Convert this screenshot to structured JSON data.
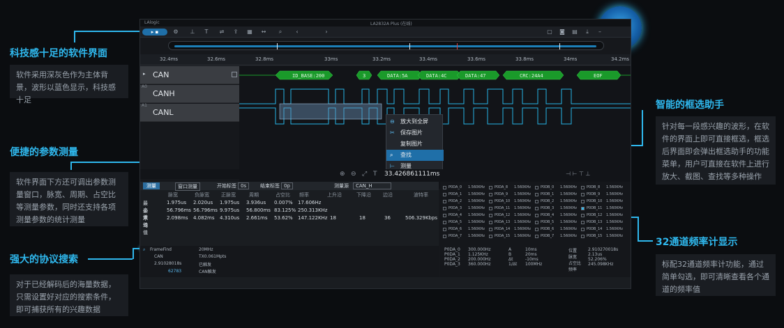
{
  "window": {
    "app_name": "LAlogic",
    "title": "LA2832A Plus (在线)"
  },
  "toolbar": {
    "run_label": "▸ ▪"
  },
  "ruler": {
    "ticks": [
      "32.4ms",
      "32.6ms",
      "32.8ms",
      "33ms",
      "33.2ms",
      "33.4ms",
      "33.6ms",
      "33.8ms",
      "34ms",
      "34.2ms"
    ]
  },
  "channels": [
    {
      "name": "CAN",
      "number": ""
    },
    {
      "name": "CANH",
      "number": "A0"
    },
    {
      "name": "CANL",
      "number": "A1"
    }
  ],
  "decode": {
    "segments": [
      "ID_BASE:200",
      "3",
      "DATA:5A",
      "DATA:4C",
      "DATA:47",
      "CRC:24A4",
      "EOF"
    ]
  },
  "context_menu": {
    "items": [
      "放大到全屏",
      "保存图片",
      "复制图片",
      "查找",
      "测量"
    ],
    "selected_index": 3
  },
  "status": {
    "cursor_time": "33.426861111ms"
  },
  "measure": {
    "tab_label": "测量",
    "mode_label": "窗口测量",
    "start_label": "开始标签",
    "start_value": "0s",
    "end_label": "结束标签",
    "end_value": "0p",
    "source_label": "测量源",
    "source_value": "CAN_H",
    "columns": [
      "",
      "脉宽",
      "负脉宽",
      "正脉宽",
      "周期",
      "占空比",
      "频率",
      "上升沿",
      "下降沿",
      "边沿",
      "波特率"
    ],
    "rows": [
      {
        "label": "最小值",
        "values": [
          "1.975us",
          "2.020us",
          "1.975us",
          "3.936us",
          "0.007%",
          "17.606Hz",
          "",
          "",
          "",
          ""
        ]
      },
      {
        "label": "最大值",
        "values": [
          "56.796ms",
          "56.796ms",
          "9.975us",
          "56.800ms",
          "83.125%",
          "250.313KHz",
          "",
          "",
          "",
          ""
        ]
      },
      {
        "label": "平均值",
        "values": [
          "2.098ms",
          "4.082ms",
          "4.310us",
          "2.661ms",
          "53.62%",
          "147.122KHz",
          "18",
          "18",
          "36",
          "506.329Kbps"
        ]
      }
    ]
  },
  "freq_counter": {
    "channels": [
      [
        "P0DA_0",
        "1.560KHz",
        "P0DA_8",
        "1.560KHz",
        "P0DB_0",
        "1.560KHz",
        "P0DB_8",
        "1.560KHz"
      ],
      [
        "P0DA_1",
        "1.560KHz",
        "P0DA_9",
        "1.560KHz",
        "P0DB_1",
        "1.560KHz",
        "P0DB_9",
        "1.560KHz"
      ],
      [
        "P0DA_2",
        "1.560KHz",
        "P0DA_10",
        "1.560KHz",
        "P0DB_2",
        "1.560KHz",
        "P0DB_10",
        "1.560KHz"
      ],
      [
        "P0DA_3",
        "1.560KHz",
        "P0DA_11",
        "1.560KHz",
        "P0DB_3",
        "1.560KHz",
        "P0DB_11",
        "1.560KHz"
      ],
      [
        "P0DA_4",
        "1.560KHz",
        "P0DA_12",
        "1.560KHz",
        "P0DB_4",
        "1.560KHz",
        "P0DB_12",
        "1.560KHz"
      ],
      [
        "P0DA_5",
        "1.560KHz",
        "P0DA_13",
        "1.560KHz",
        "P0DB_5",
        "1.560KHz",
        "P0DB_13",
        "1.560KHz"
      ],
      [
        "P0DA_6",
        "1.560KHz",
        "P0DA_14",
        "1.560KHz",
        "P0DB_6",
        "1.560KHz",
        "P0DB_14",
        "1.560KHz"
      ],
      [
        "P0DA_7",
        "1.560KHz",
        "P0DA_15",
        "1.560KHz",
        "P0DB_7",
        "1.560KHz",
        "P0DB_15",
        "1.560KHz"
      ]
    ]
  },
  "search": {
    "title": "FrameFind",
    "protocol": "CAN",
    "value": "2.91028018s",
    "result": "62783",
    "results_header": "20MHz",
    "result_items": [
      "TX0.061Mpts",
      "已触发",
      "CAN触发"
    ]
  },
  "summary": {
    "left": [
      [
        "P0DA_0",
        "300.000Hz"
      ],
      [
        "P0DA_1",
        "1.125KHz"
      ],
      [
        "P0DA_2",
        "200.000Hz"
      ],
      [
        "P0DA_3",
        "360.000Hz"
      ]
    ],
    "mid": [
      [
        "A",
        "10ms"
      ],
      [
        "B",
        "20ms"
      ],
      [
        "Δt",
        "-10ms"
      ],
      [
        "1/Δt",
        "100MHz"
      ]
    ],
    "right": [
      [
        "位置",
        "2.910270018s"
      ],
      [
        "脉宽",
        "2.13us"
      ],
      [
        "占空比",
        "52.206%"
      ],
      [
        "频率",
        "245.098KHz"
      ]
    ]
  },
  "callouts": [
    {
      "title": "科技感十足的软件界面",
      "body": "软件采用深灰色作为主体背景，波形以蓝色显示，科技感十足"
    },
    {
      "title": "便捷的参数测量",
      "body": "软件界面下方还可调出参数测量窗口，脉宽、周期、占空比等测量参数，同时还支持各项测量参数的统计测量"
    },
    {
      "title": "强大的协议搜索",
      "body": "对于已经解码后的海量数据，只需设置好对应的搜索条件，即可捕获所有的兴趣数据"
    },
    {
      "title": "智能的框选助手",
      "body": "针对每一段感兴趣的波形，在软件的界面上即可直接框选，框选后界面即会弹出框选助手的功能菜单，用户可直接在软件上进行放大、截图、查找等多种操作"
    },
    {
      "title": "32通道频率计显示",
      "body": "标配32通道频率计功能，通过简单勾选，即可清晰查看各个通道的频率值"
    }
  ],
  "colors": {
    "accent": "#2fb8ee",
    "wave": "#27b3e6",
    "decode": "#1a9a2a",
    "selection": "#1f6fa8"
  }
}
